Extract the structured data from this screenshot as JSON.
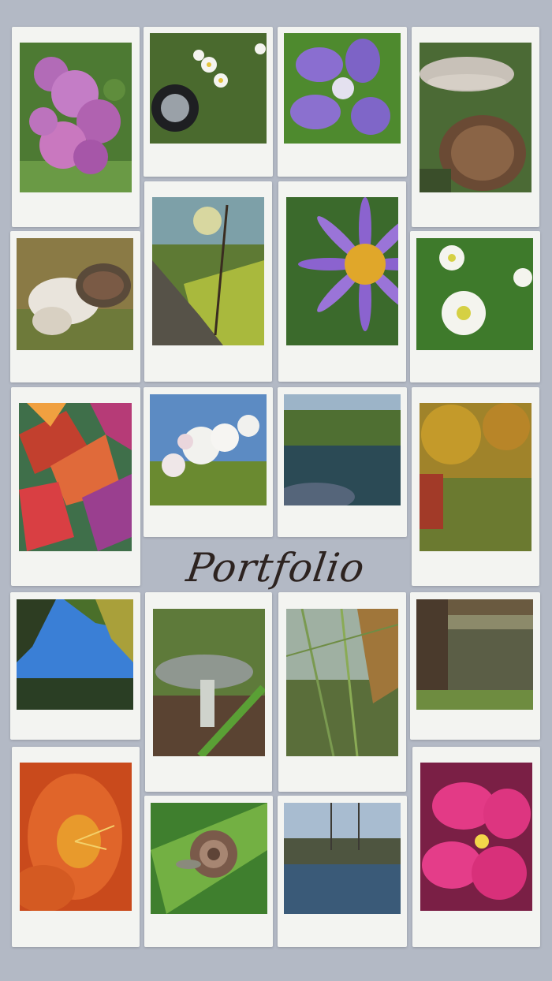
{
  "title": "Portfolio"
}
